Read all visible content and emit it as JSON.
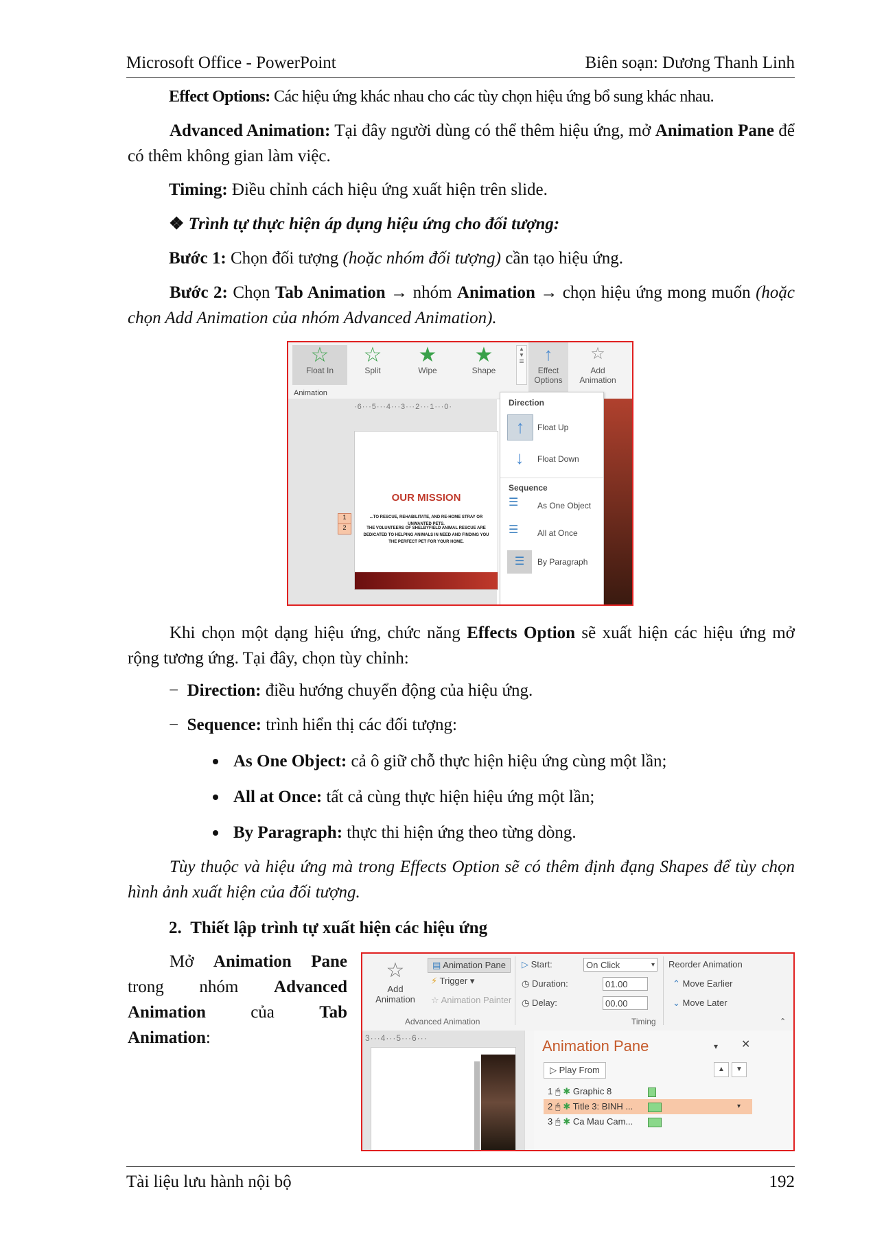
{
  "header": {
    "left": "Microsoft Office - PowerPoint",
    "right": "Biên soạn: Dương Thanh Linh"
  },
  "p1": {
    "bold": "Effect Options:",
    "text": " Các hiệu ứng khác nhau cho các tùy chọn hiệu ứng bổ sung khác nhau."
  },
  "p2": {
    "b1": "Advanced Animation:",
    "t1": " Tại đây người dùng có thể thêm hiệu ứng, mở ",
    "b2": "Animation Pane",
    "t2": " để có thêm không gian làm việc."
  },
  "p3": {
    "bold": "Timing:",
    "text": " Điều chỉnh cách hiệu ứng xuất hiện trên slide."
  },
  "p4": {
    "symbol": "❖",
    "text": "Trình tự thực hiện áp dụng hiệu ứng cho đối tượng:"
  },
  "p5": {
    "bold": "Bước 1:",
    "t1": " Chọn đối tượng ",
    "italic": "(hoặc nhóm đối tượng)",
    "t2": " cần tạo hiệu ứng."
  },
  "p6": {
    "bold": "Bước 2:",
    "t1": " Chọn ",
    "b2": "Tab Animation",
    "arrow1": " → ",
    "t2": "nhóm ",
    "b3": "Animation",
    "arrow2": " → ",
    "t3": "chọn hiệu ứng mong muốn ",
    "italic": "(hoặc chọn Add Animation của nhóm Advanced Animation)."
  },
  "fig1": {
    "tiles": [
      "Float In",
      "Split",
      "Wipe",
      "Shape"
    ],
    "effect_options": "Effect Options",
    "add_animation": "Add Animation",
    "group_label": "Animation",
    "ruler": "·6···5···4···3···2···1···0·",
    "direction_header": "Direction",
    "float_up": "Float Up",
    "float_down": "Float Down",
    "sequence_header": "Sequence",
    "as_one_object": "As One Object",
    "all_at_once": "All at Once",
    "by_paragraph": "By Paragraph",
    "slide_title": "OUR MISSION",
    "slide_line1": "...TO RESCUE, REHABILITATE, AND RE-HOME STRAY OR UNWANTED PETS.",
    "slide_line2": "THE VOLUNTEERS OF SHELBYFIELD ANIMAL RESCUE ARE DEDICATED TO HELPING ANIMALS IN NEED AND FINDING YOU THE PERFECT PET FOR YOUR HOME.",
    "marker1": "1",
    "marker2": "2"
  },
  "p7": {
    "t1": "Khi chọn một dạng hiệu ứng, chức năng ",
    "bold": "Effects Option",
    "t2": " sẽ xuất hiện các hiệu ứng mở rộng tương ứng. Tại đây, chọn tùy chỉnh:"
  },
  "dash1": {
    "mark": "−",
    "bold": "Direction:",
    "text": " điều hướng chuyển động của hiệu ứng."
  },
  "dash2": {
    "mark": "−",
    "bold": "Sequence:",
    "text": " trình hiển thị các đối tượng:"
  },
  "bul1": {
    "bold": "As One Object:",
    "text": " cả ô giữ chỗ thực hiện hiệu ứng cùng một lần;"
  },
  "bul2": {
    "bold": "All at Once:",
    "text": " tất cả cùng thực hiện hiệu ứng một lần;"
  },
  "bul3": {
    "bold": "By Paragraph:",
    "text": " thực thi hiện ứng theo từng dòng."
  },
  "p8": {
    "italic": "Tùy thuộc và hiệu ứng mà trong Effects Option sẽ có thêm định đạng Shapes để tùy chọn hình ảnh xuất hiện của đối tượng."
  },
  "heading2": {
    "num": "2.",
    "text": "Thiết lập trình tự xuất hiện các hiệu ứng"
  },
  "p9": {
    "t1": "Mở ",
    "b1": "Animation Pane",
    "t2": " trong nhóm ",
    "b2": "Advanced Animation",
    "t3": " của ",
    "b3": "Tab Animation",
    "t4": ":"
  },
  "fig2": {
    "add_animation": "Add Animation",
    "animation_pane": "Animation Pane",
    "trigger": "Trigger",
    "animation_painter": "Animation Painter",
    "group_advanced": "Advanced Animation",
    "start_label": "Start:",
    "start_value": "On Click",
    "duration_label": "Duration:",
    "duration_value": "01.00",
    "delay_label": "Delay:",
    "delay_value": "00.00",
    "group_timing": "Timing",
    "reorder": "Reorder Animation",
    "move_earlier": "Move Earlier",
    "move_later": "Move Later",
    "ruler": "3···4···5···6···",
    "pane_title": "Animation Pane",
    "play_from": "Play From",
    "items": [
      {
        "num": "1",
        "label": "Graphic 8"
      },
      {
        "num": "2",
        "label": "Title 3: BINH ..."
      },
      {
        "num": "3",
        "label": "Ca Mau Cam..."
      }
    ]
  },
  "footer": {
    "left": "Tài liệu lưu hành nội bộ",
    "right": "192"
  },
  "colors": {
    "frame": "#e02020",
    "star": "#3aa14a",
    "accent": "#c0392b",
    "pane_title": "#c55a2b",
    "selected_row": "#f8c8a8"
  }
}
